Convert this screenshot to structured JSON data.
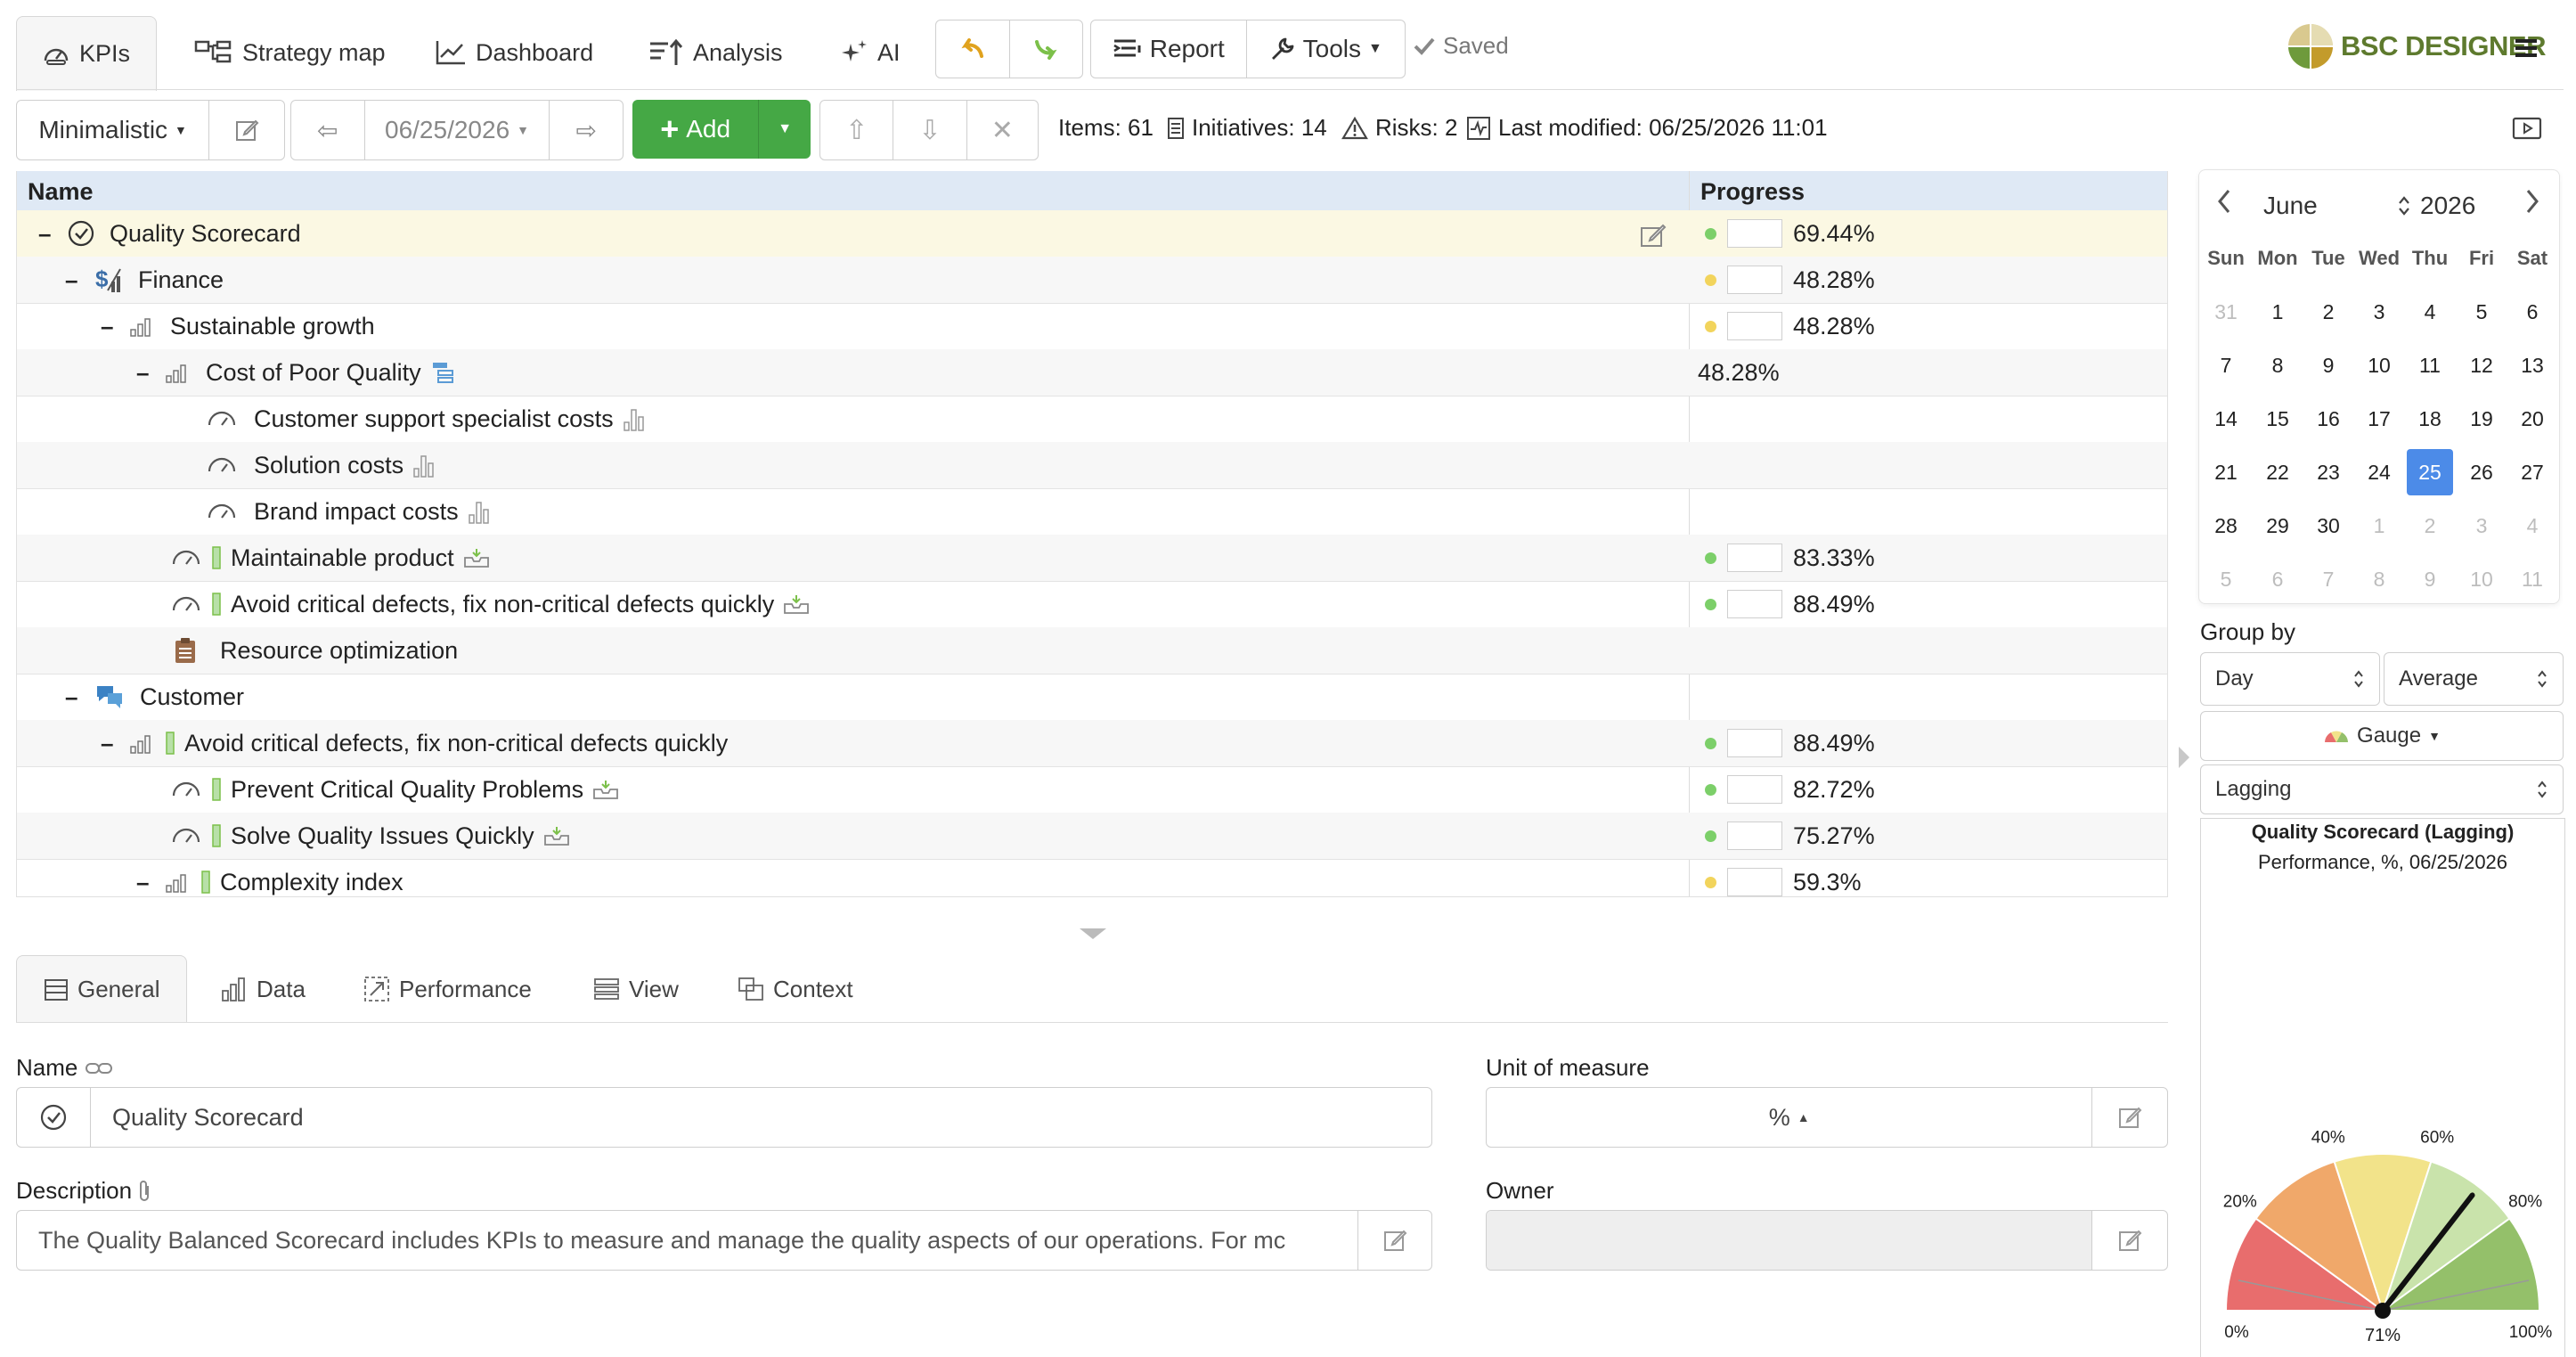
{
  "nav": {
    "tabs": [
      {
        "label": "KPIs",
        "icon": "gauge-icon"
      },
      {
        "label": "Strategy map",
        "icon": "hierarchy-icon"
      },
      {
        "label": "Dashboard",
        "icon": "line-chart-icon"
      },
      {
        "label": "Analysis",
        "icon": "sort-icon"
      },
      {
        "label": "AI",
        "icon": "sparkle-icon"
      }
    ],
    "report_label": "Report",
    "tools_label": "Tools",
    "saved_label": "Saved",
    "brand": "BSC DESIGNER"
  },
  "toolbar": {
    "view_mode": "Minimalistic",
    "date": "06/25/2026",
    "add_label": "Add",
    "items": "Items: 61",
    "initiatives": "Initiatives: 14",
    "risks": "Risks: 2",
    "last_modified": "Last modified: 06/25/2026 11:01"
  },
  "grid": {
    "col_name": "Name",
    "col_progress": "Progress",
    "rows": [
      {
        "name": "Quality Scorecard",
        "progress": "69.44%",
        "status_color": "#7ccf69"
      },
      {
        "name": "Finance",
        "progress": "48.28%",
        "status_color": "#f2d45c"
      },
      {
        "name": "Sustainable growth",
        "progress": "48.28%",
        "status_color": "#f2d45c"
      },
      {
        "name": "Cost of Poor Quality",
        "progress": "48.28%"
      },
      {
        "name": "Customer support specialist costs",
        "progress": ""
      },
      {
        "name": "Solution costs",
        "progress": ""
      },
      {
        "name": "Brand impact costs",
        "progress": ""
      },
      {
        "name": "Maintainable product",
        "progress": "83.33%",
        "status_color": "#7ccf69"
      },
      {
        "name": "Avoid critical defects, fix non-critical defects quickly",
        "progress": "88.49%",
        "status_color": "#7ccf69"
      },
      {
        "name": "Resource optimization",
        "progress": ""
      },
      {
        "name": "Customer",
        "progress": ""
      },
      {
        "name": "Avoid critical defects, fix non-critical defects quickly",
        "progress": "88.49%",
        "status_color": "#7ccf69"
      },
      {
        "name": "Prevent Critical Quality Problems",
        "progress": "82.72%",
        "status_color": "#7ccf69"
      },
      {
        "name": "Solve Quality Issues Quickly",
        "progress": "75.27%",
        "status_color": "#7ccf69"
      },
      {
        "name": "Complexity index",
        "progress": "59.3%",
        "status_color": "#f2d45c"
      }
    ]
  },
  "detail_tabs": [
    "General",
    "Data",
    "Performance",
    "View",
    "Context"
  ],
  "general": {
    "name_label": "Name",
    "name_value": "Quality Scorecard",
    "unit_label": "Unit of measure",
    "unit_value": "%",
    "description_label": "Description",
    "description_value": "The Quality Balanced Scorecard includes KPIs to measure and manage the quality aspects of our operations. For mc",
    "owner_label": "Owner",
    "owner_value": ""
  },
  "calendar": {
    "month": "June",
    "year": "2026",
    "weekdays": [
      "Sun",
      "Mon",
      "Tue",
      "Wed",
      "Thu",
      "Fri",
      "Sat"
    ],
    "weeks": [
      [
        "31",
        "1",
        "2",
        "3",
        "4",
        "5",
        "6"
      ],
      [
        "7",
        "8",
        "9",
        "10",
        "11",
        "12",
        "13"
      ],
      [
        "14",
        "15",
        "16",
        "17",
        "18",
        "19",
        "20"
      ],
      [
        "21",
        "22",
        "23",
        "24",
        "25",
        "26",
        "27"
      ],
      [
        "28",
        "29",
        "30",
        "1",
        "2",
        "3",
        "4"
      ],
      [
        "5",
        "6",
        "7",
        "8",
        "9",
        "10",
        "11"
      ]
    ],
    "selected_day": "25"
  },
  "side": {
    "group_by_label": "Group by",
    "group_by_value": "Day",
    "aggregate_value": "Average",
    "chart_type": "Gauge",
    "indicator_type": "Lagging",
    "chart_title": "Quality Scorecard (Lagging)",
    "chart_subtitle": "Performance, %, 06/25/2026"
  },
  "chart_data": {
    "type": "gauge",
    "title": "Quality Scorecard (Lagging)",
    "subtitle": "Performance, %, 06/25/2026",
    "value": 71,
    "value_label": "71%",
    "min": 0,
    "max": 100,
    "ticks": [
      "0%",
      "20%",
      "40%",
      "60%",
      "80%",
      "100%"
    ],
    "bands": [
      {
        "from": 0,
        "to": 20,
        "color": "#e86d6d"
      },
      {
        "from": 20,
        "to": 40,
        "color": "#f0a86a"
      },
      {
        "from": 40,
        "to": 60,
        "color": "#f2e38a"
      },
      {
        "from": 60,
        "to": 80,
        "color": "#c9e3ab"
      },
      {
        "from": 80,
        "to": 100,
        "color": "#94c06a"
      }
    ]
  },
  "colors": {
    "accent_green": "#45a845",
    "header_blue": "#dfe9f5",
    "selected_row": "#fbf8e3",
    "calendar_selected": "#4c8be8"
  }
}
